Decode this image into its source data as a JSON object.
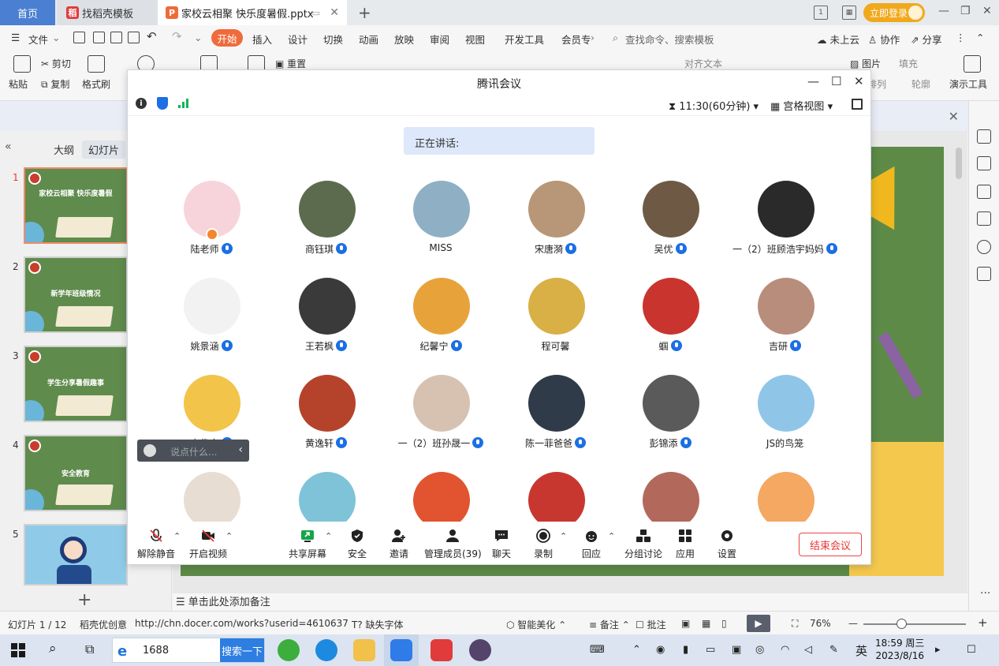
{
  "wps": {
    "tabs": {
      "home": "首页",
      "docer": "找稻壳模板",
      "document": "家校云相聚  快乐度暑假.pptx"
    },
    "login_button": "立即登录",
    "menu": {
      "file": "文件",
      "start": "开始",
      "items": [
        "插入",
        "设计",
        "切换",
        "动画",
        "放映",
        "审阅",
        "视图",
        "开发工具",
        "会员专"
      ],
      "search_placeholder": "查找命令、搜索模板",
      "cloud": "未上云",
      "collab": "协作",
      "share": "分享"
    },
    "ribbon": {
      "paste": "粘贴",
      "cut": "剪切",
      "copy": "复制",
      "format_painter": "格式刷",
      "reset": "重置",
      "align_text": "对齐文本",
      "image": "图片",
      "fill": "填充",
      "arrange": "排列",
      "outline": "轮廓",
      "presenter": "演示工具"
    },
    "left_panel": {
      "tab_outline": "大纲",
      "tab_slides": "幻灯片",
      "slides": [
        {
          "num": "1",
          "title": "家校云相聚  快乐度暑假"
        },
        {
          "num": "2",
          "title": "新学年班级情况"
        },
        {
          "num": "3",
          "title": "学生分享暑假趣事"
        },
        {
          "num": "4",
          "title": "安全教育"
        },
        {
          "num": "5",
          "title": ""
        }
      ]
    },
    "notes_placeholder": "单击此处添加备注",
    "status": {
      "slide_counter": "幻灯片 1 / 12",
      "template": "稻壳优创意",
      "url": "http://chn.docer.com/works?userid=4610637",
      "missing_font": "缺失字体",
      "smart_beautify": "智能美化",
      "notes": "备注",
      "comments": "批注",
      "zoom": "76%"
    }
  },
  "meeting": {
    "title": "腾讯会议",
    "time": "11:30(60分钟)",
    "view_mode": "宫格视图",
    "speaking_label": "正在讲话:",
    "chat_placeholder": "说点什么...",
    "participants": [
      {
        "name": "陆老师",
        "host": true,
        "color": "#f7d4dc"
      },
      {
        "name": "商钰琪",
        "color": "#5c6b4e"
      },
      {
        "name": "MISS",
        "color": "#8fb0c4",
        "no_mic": true
      },
      {
        "name": "宋唐漪",
        "color": "#b89678"
      },
      {
        "name": "吴优",
        "color": "#6e5a44"
      },
      {
        "name": "一（2）班顾浩宇妈妈",
        "color": "#2a2a2a"
      },
      {
        "name": "姚景涵",
        "color": "#f2f2f2"
      },
      {
        "name": "王若枫",
        "color": "#3a3a3a"
      },
      {
        "name": "纪馨宁",
        "color": "#e7a33a"
      },
      {
        "name": "程可馨",
        "color": "#d8b046",
        "no_mic": true
      },
      {
        "name": "蝈",
        "color": "#c9342f"
      },
      {
        "name": "吉研",
        "color": "#b98d7b"
      },
      {
        "name": "安俊彦",
        "color": "#f2c44a"
      },
      {
        "name": "黄逸轩",
        "color": "#b5432b"
      },
      {
        "name": "一（2）班孙晟一",
        "color": "#d7c2b2"
      },
      {
        "name": "陈一菲爸爸",
        "color": "#2f3b48"
      },
      {
        "name": "彭锦添",
        "color": "#5a5a5a"
      },
      {
        "name": "JS的鸟笼",
        "color": "#8fc6e8",
        "no_mic": true
      },
      {
        "name": "",
        "color": "#e8ddd3"
      },
      {
        "name": "",
        "color": "#7fc3d9"
      },
      {
        "name": "",
        "color": "#e2542f"
      },
      {
        "name": "",
        "color": "#c8372f"
      },
      {
        "name": "",
        "color": "#b2695b"
      },
      {
        "name": "",
        "color": "#f4a862"
      }
    ],
    "controls": {
      "unmute": "解除静音",
      "start_video": "开启视频",
      "share_screen": "共享屏幕",
      "security": "安全",
      "invite": "邀请",
      "manage_members": "管理成员(39)",
      "chat": "聊天",
      "record": "录制",
      "react": "回应",
      "breakout": "分组讨论",
      "apps": "应用",
      "settings": "设置",
      "end_meeting": "结束会议"
    }
  },
  "taskbar": {
    "search_value": "1688",
    "search_button": "搜索一下",
    "ime": "英",
    "time": "18:59 周三",
    "date": "2023/8/16"
  },
  "colors": {
    "wps_accent": "#ef6b3b",
    "meeting_blue": "#1c6fe4",
    "end_red": "#e33333",
    "slide_green": "#5d8a47"
  }
}
